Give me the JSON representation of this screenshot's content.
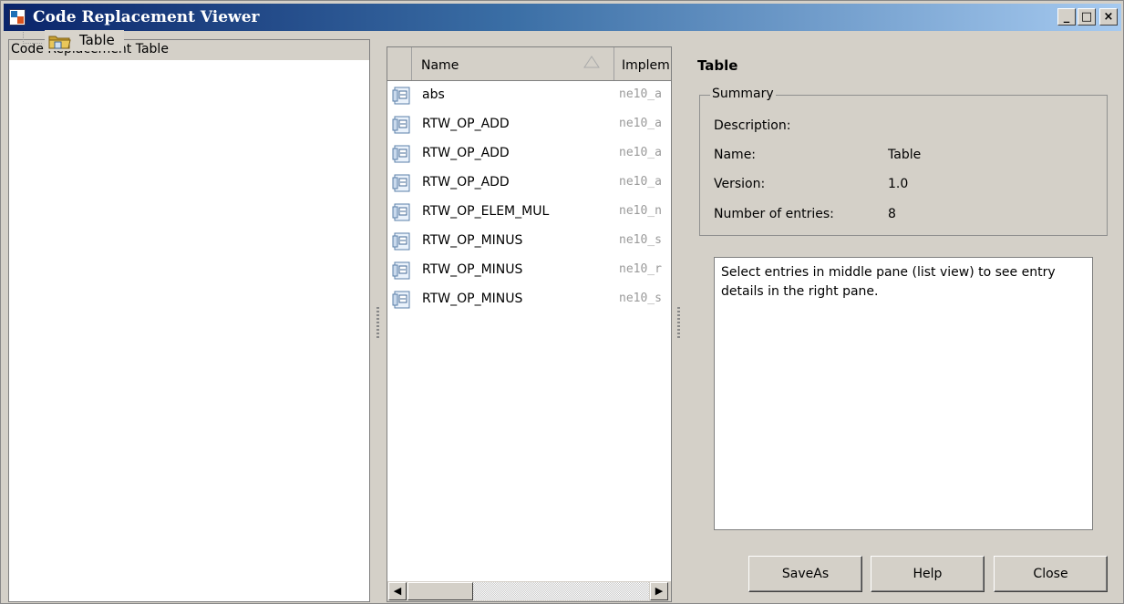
{
  "window": {
    "title": "Code Replacement Viewer",
    "controls": {
      "minimize": "_",
      "maximize": "□",
      "close": "×"
    }
  },
  "left_pane": {
    "header": "Code Replacement Table",
    "tree": [
      {
        "label": "Table",
        "icon": "table-folder-icon"
      }
    ]
  },
  "list": {
    "columns": [
      {
        "label": "Name",
        "sort": "ascending"
      },
      {
        "label": "Implem"
      }
    ],
    "rows": [
      {
        "name": "abs",
        "impl": "ne10_a"
      },
      {
        "name": "RTW_OP_ADD",
        "impl": "ne10_a"
      },
      {
        "name": "RTW_OP_ADD",
        "impl": "ne10_a"
      },
      {
        "name": "RTW_OP_ADD",
        "impl": "ne10_a"
      },
      {
        "name": "RTW_OP_ELEM_MUL",
        "impl": "ne10_n"
      },
      {
        "name": "RTW_OP_MINUS",
        "impl": "ne10_s"
      },
      {
        "name": "RTW_OP_MINUS",
        "impl": "ne10_r"
      },
      {
        "name": "RTW_OP_MINUS",
        "impl": "ne10_s"
      }
    ],
    "scroll_left": "◀",
    "scroll_right": "▶"
  },
  "details": {
    "title": "Table",
    "summary_legend": "Summary",
    "description_label": "Description:",
    "name_label": "Name:",
    "name_value": "Table",
    "version_label": "Version:",
    "version_value": "1.0",
    "entries_label": "Number of entries:",
    "entries_value": "8",
    "info_text": "Select entries in middle pane (list view) to see entry details in the right pane."
  },
  "buttons": {
    "save_as": "SaveAs",
    "help": "Help",
    "close": "Close"
  },
  "colors": {
    "titlebar_start": "#0a246a",
    "titlebar_end": "#a6caf0",
    "background": "#d4d0c8"
  }
}
